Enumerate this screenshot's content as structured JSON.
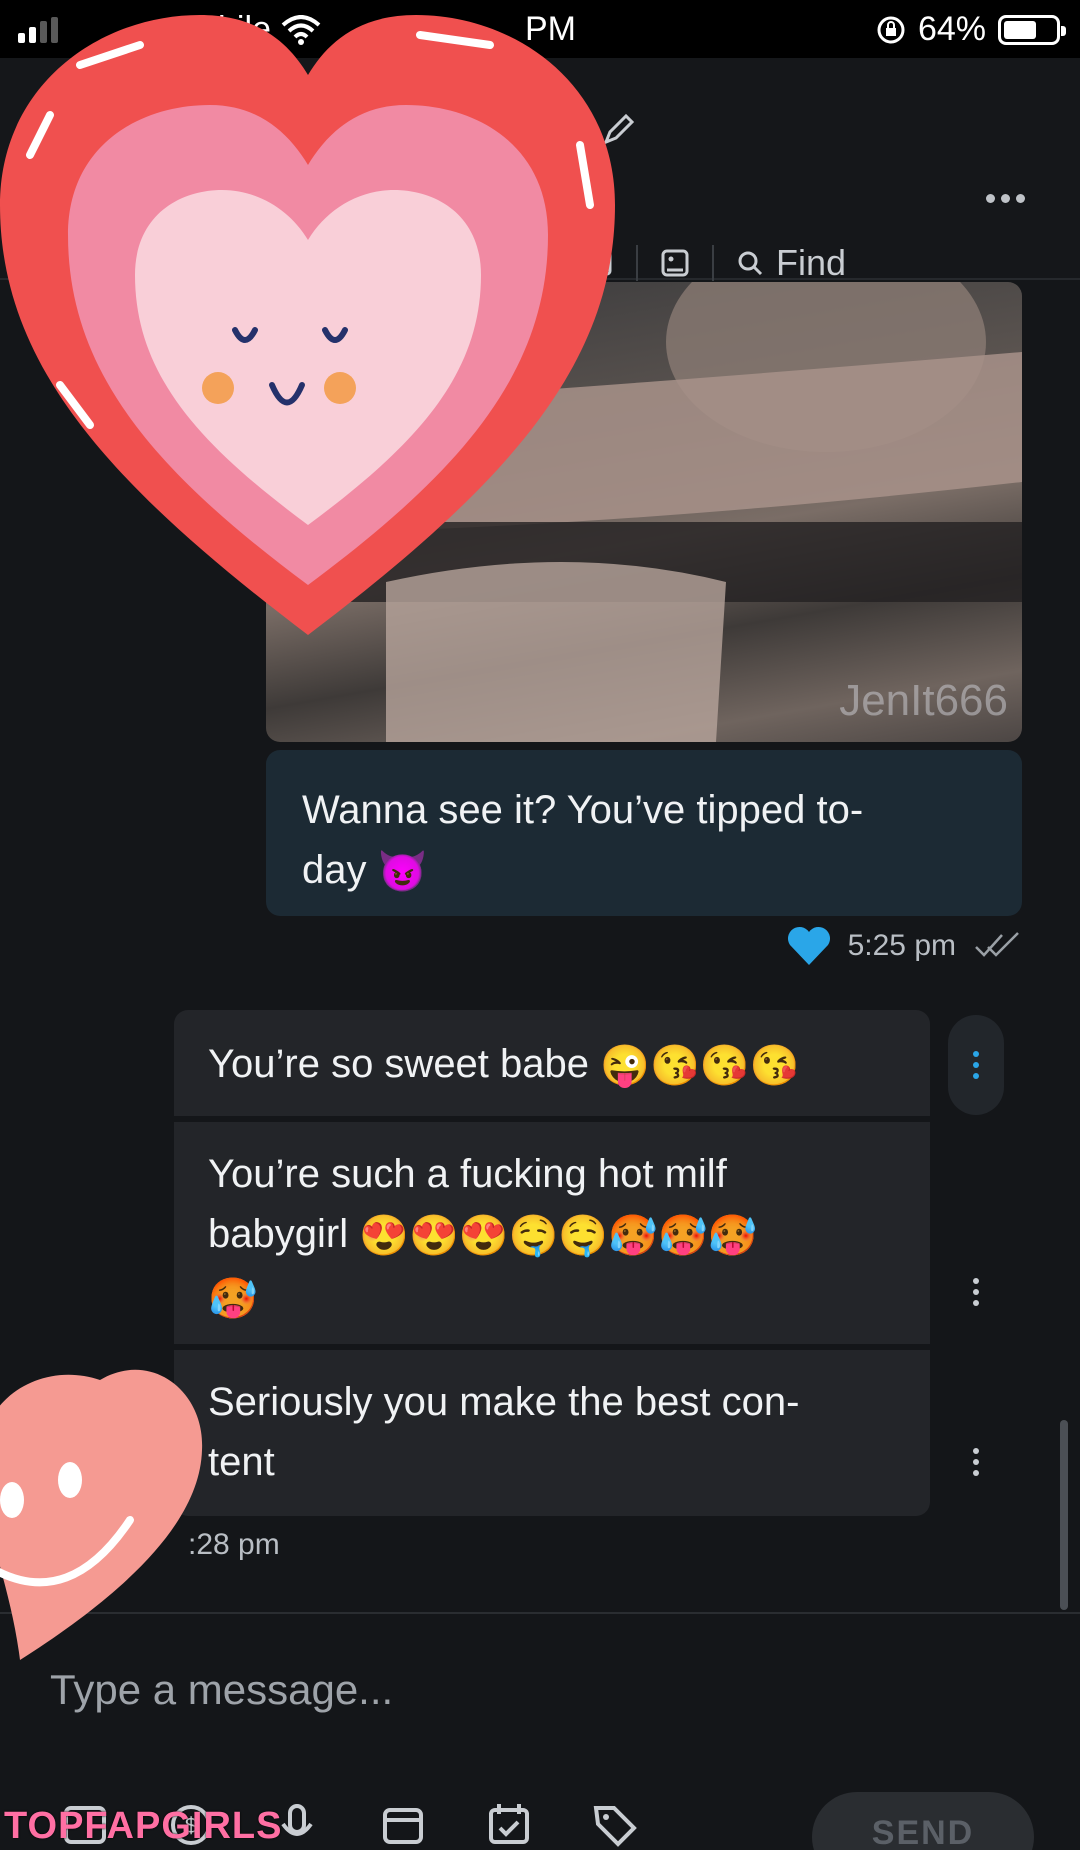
{
  "status_bar": {
    "carrier": "bile",
    "time": "PM",
    "battery": "64%",
    "battery_level": 0.64
  },
  "header": {
    "find_label": "Find"
  },
  "media": {
    "watermark": "JenIt666"
  },
  "messages": {
    "outgoing": {
      "text": "Wanna see it? You’ve tipped to-",
      "text_line2": "day",
      "emoji": "😈",
      "time": "5:25 pm"
    },
    "incoming": [
      {
        "text": "You’re so sweet babe",
        "emojis": "😜😘😘😘"
      },
      {
        "text": "You’re such a fucking hot milf",
        "text_line2": "babygirl",
        "emojis": "😍😍😍🤤🤤🥵🥵🥵",
        "emojis_line3": "🥵"
      },
      {
        "text": "Seriously you make the best con-",
        "text_line2": "tent"
      }
    ],
    "incoming_time": ":28 pm"
  },
  "composer": {
    "placeholder": "Type a message...",
    "send_label": "SEND"
  },
  "overlay": {
    "site_watermark": "TOPFAPGIRLS"
  },
  "colors": {
    "background": "#141619",
    "incoming_bubble": "#232529",
    "outgoing_bubble": "#1c2a34",
    "accent": "#2aa6e8"
  }
}
